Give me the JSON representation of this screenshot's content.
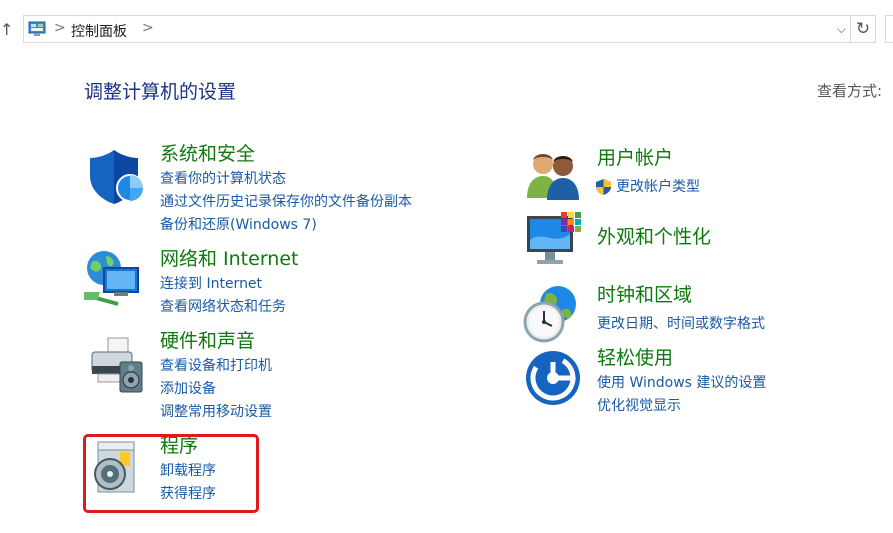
{
  "nav": {
    "up_glyph": "↑"
  },
  "address": {
    "icon": "control-panel-icon",
    "separator": ">",
    "crumb": "控制面板",
    "dropdown_glyph": "⌵",
    "refresh_glyph": "↻"
  },
  "page": {
    "title": "调整计算机的设置",
    "view_label": "查看方式:"
  },
  "categories": [
    {
      "title": "系统和安全",
      "icon": "shield-icon",
      "links": [
        "查看你的计算机状态",
        "通过文件历史记录保存你的文件备份副本",
        "备份和还原(Windows 7)"
      ]
    },
    {
      "title": "网络和 Internet",
      "icon": "network-icon",
      "links": [
        "连接到 Internet",
        "查看网络状态和任务"
      ]
    },
    {
      "title": "硬件和声音",
      "icon": "printer-icon",
      "links": [
        "查看设备和打印机",
        "添加设备",
        "调整常用移动设置"
      ]
    },
    {
      "title": "程序",
      "icon": "programs-disc-icon",
      "links": [
        "卸载程序",
        "获得程序"
      ]
    },
    {
      "title": "用户帐户",
      "icon": "users-icon",
      "links": [
        "更改帐户类型"
      ],
      "link_icon": "uac-shield-icon"
    },
    {
      "title": "外观和个性化",
      "icon": "monitor-palette-icon",
      "links": []
    },
    {
      "title": "时钟和区域",
      "icon": "clock-globe-icon",
      "links": [
        "更改日期、时间或数字格式"
      ]
    },
    {
      "title": "轻松使用",
      "icon": "ease-of-access-icon",
      "links": [
        "使用 Windows 建议的设置",
        "优化视觉显示"
      ]
    }
  ],
  "colors": {
    "title_blue": "#1e3287",
    "category_green": "#0e7a0e",
    "link_blue": "#1a5aa6",
    "highlight_red": "#e0191c"
  }
}
